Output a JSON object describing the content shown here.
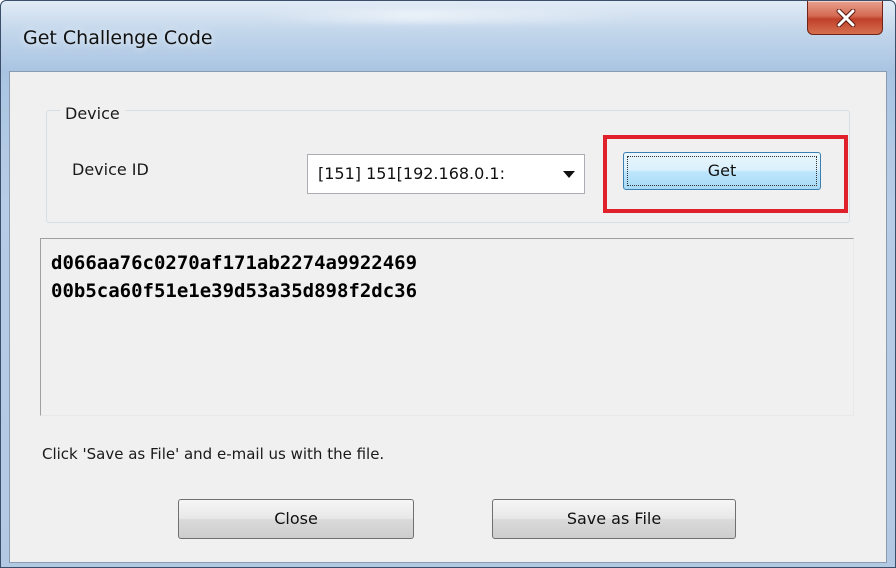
{
  "window": {
    "title": "Get Challenge Code",
    "close_icon": "close-x-icon"
  },
  "device_group": {
    "label": "Device",
    "device_id_label": "Device ID",
    "device_select_value": "[151] 151[192.168.0.1:",
    "get_button": "Get"
  },
  "output": {
    "lines": [
      "d066aa76c0270af171ab2274a9922469",
      "00b5ca60f51e1e39d53a35d898f2dc36"
    ]
  },
  "instruction": "Click 'Save as File' and e-mail us with the file.",
  "buttons": {
    "close": "Close",
    "save_as_file": "Save as File"
  },
  "colors": {
    "highlight": "#e0202a",
    "close_button": "#c0402a"
  }
}
